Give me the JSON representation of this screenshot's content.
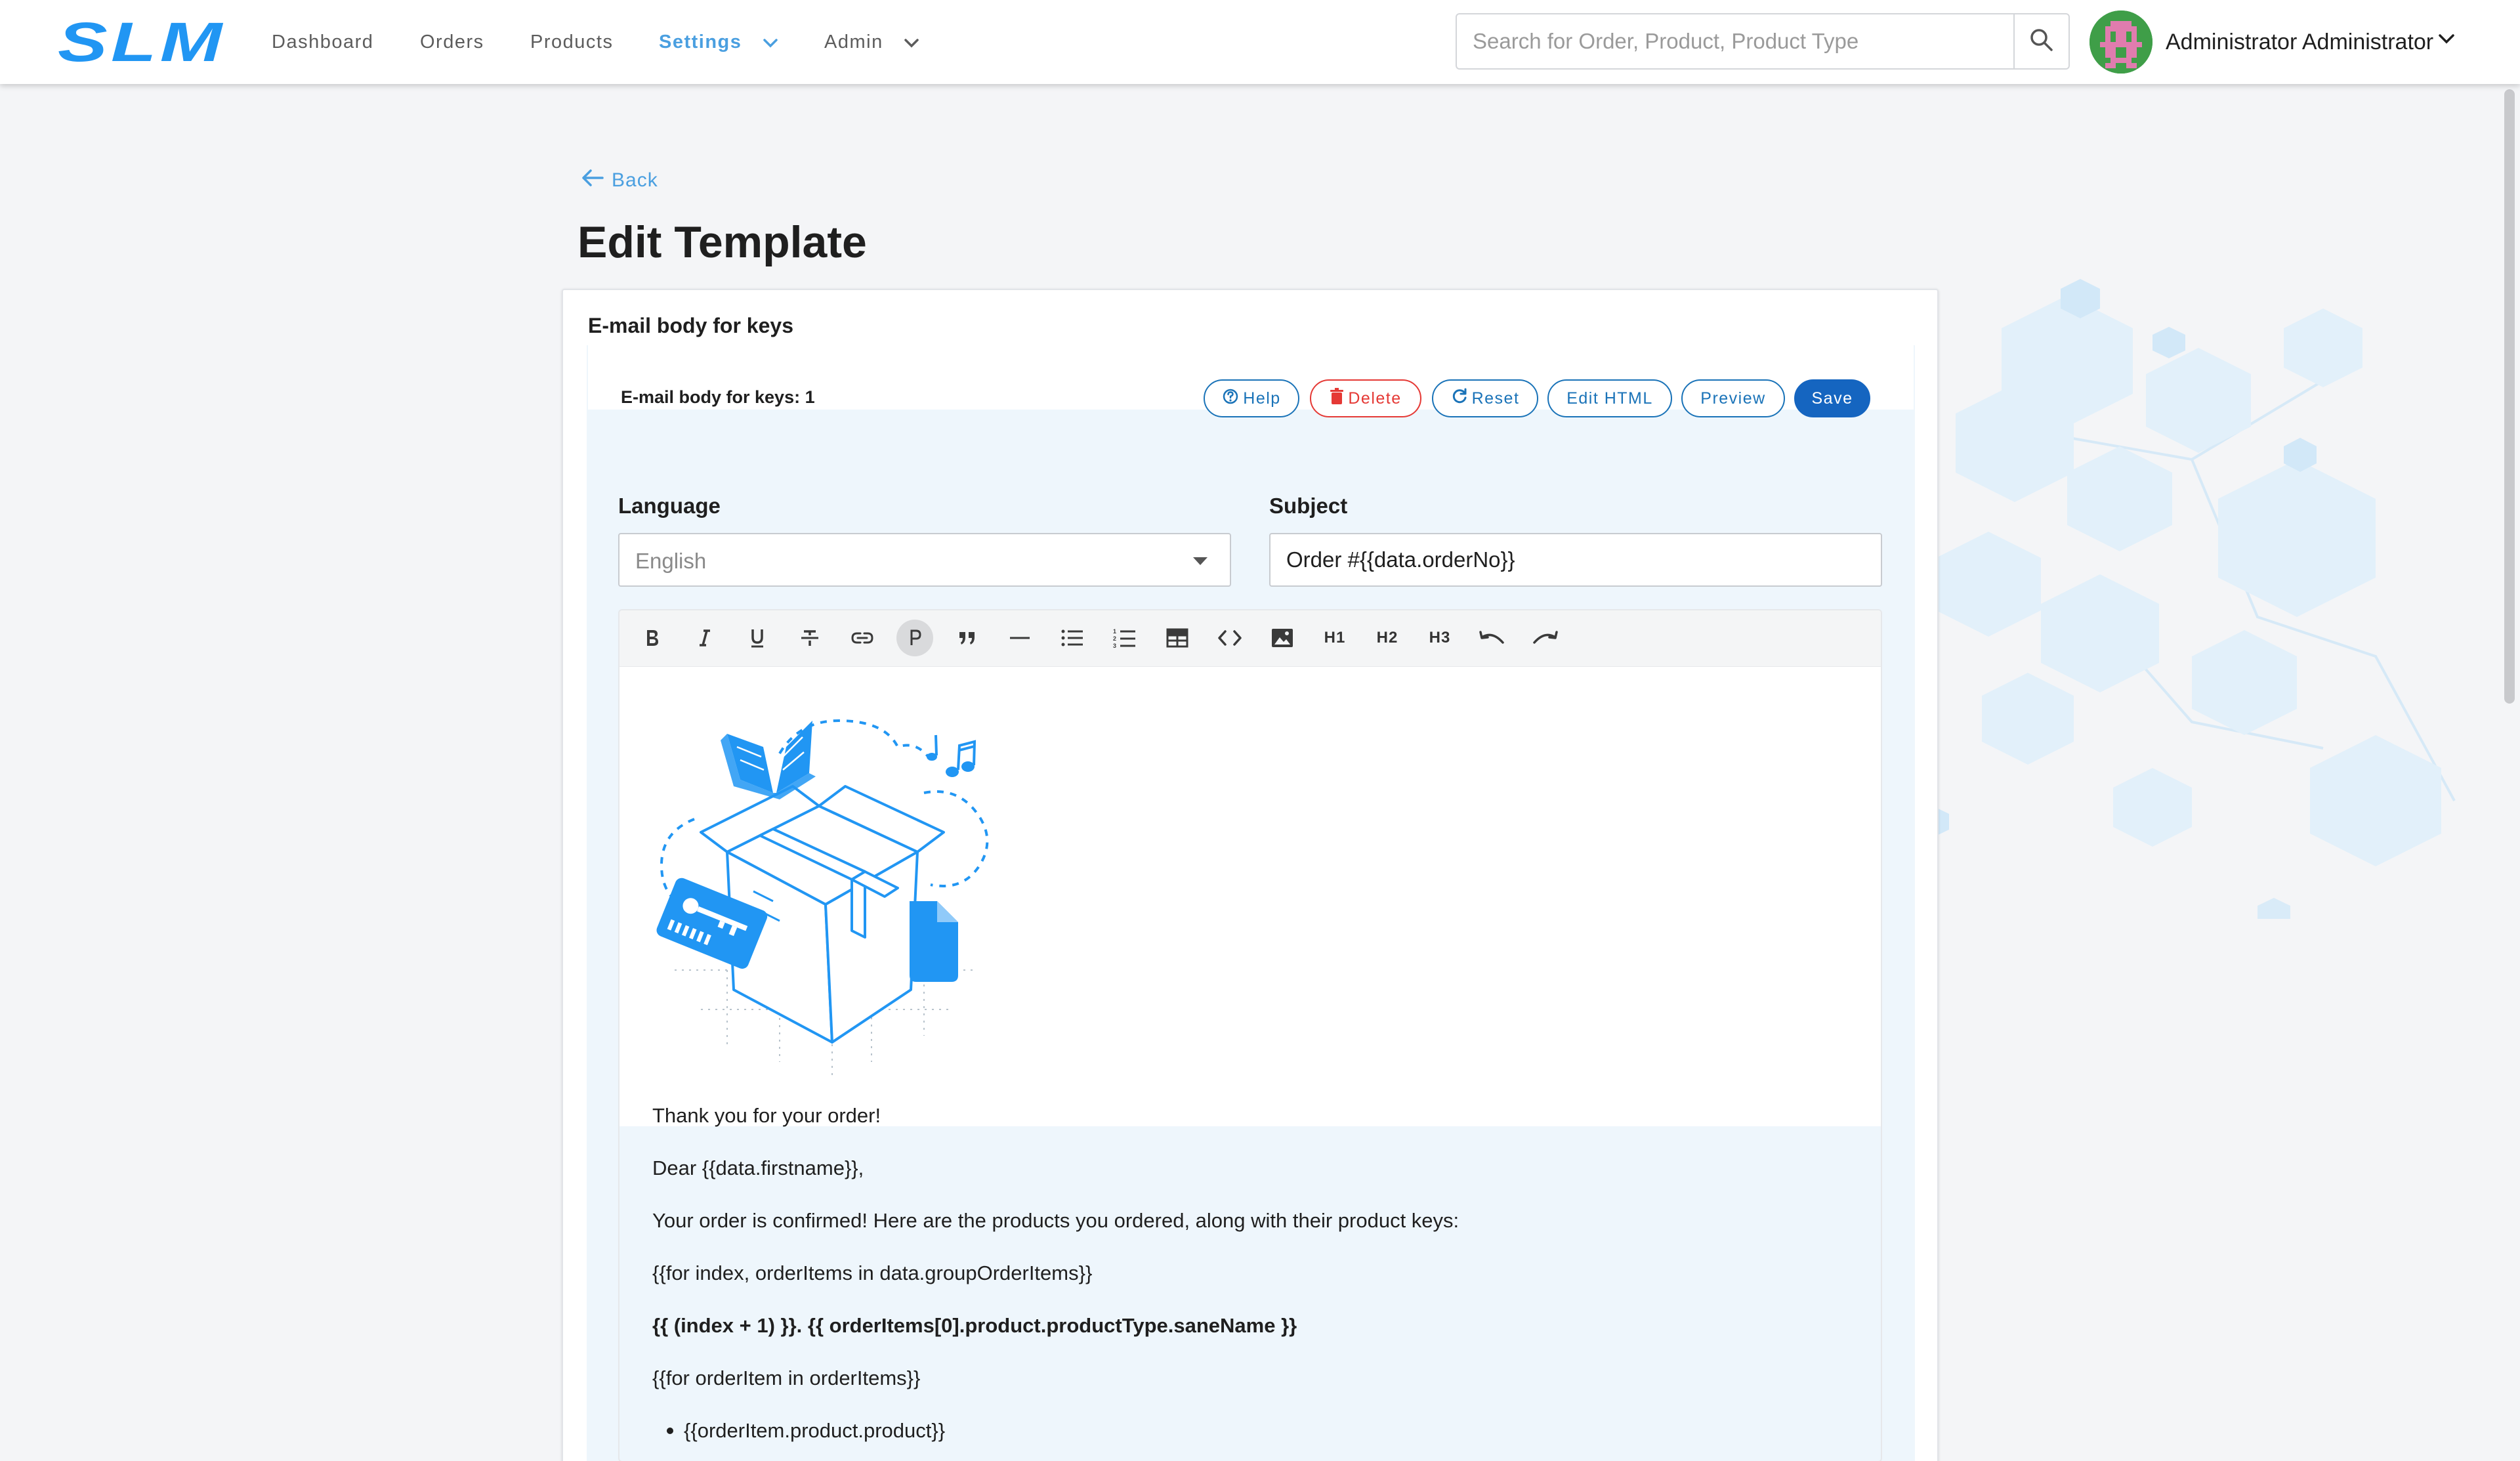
{
  "brand": {
    "logo": "SLM",
    "accent": "#2196f3"
  },
  "nav": {
    "dashboard": "Dashboard",
    "orders": "Orders",
    "products": "Products",
    "settings": "Settings",
    "admin": "Admin"
  },
  "search": {
    "placeholder": "Search for Order, Product, Product Type"
  },
  "user": {
    "name": "Administrator Administrator"
  },
  "page": {
    "back": "Back",
    "title": "Edit Template"
  },
  "template": {
    "card_title": "E-mail body for keys",
    "inner_title": "E-mail body for keys: 1",
    "buttons": {
      "help": "Help",
      "delete": "Delete",
      "reset": "Reset",
      "edit_html": "Edit HTML",
      "preview": "Preview",
      "save": "Save"
    },
    "language_label": "Language",
    "language_value": "English",
    "subject_label": "Subject",
    "subject_value": "Order #{{data.orderNo}}"
  },
  "toolbar": {
    "icons": [
      "bold-icon",
      "italic-icon",
      "underline-icon",
      "strikethrough-icon",
      "link-icon",
      "paragraph-icon",
      "blockquote-icon",
      "horizontal-rule-icon",
      "bullet-list-icon",
      "ordered-list-icon",
      "table-icon",
      "code-icon",
      "image-icon",
      "heading-1-icon",
      "heading-2-icon",
      "heading-3-icon",
      "undo-icon",
      "redo-icon"
    ],
    "h1": "H1",
    "h2": "H2",
    "h3": "H3",
    "paragraph": "P"
  },
  "editor": {
    "line1": "Thank you for your order!",
    "line2": "Dear {{data.firstname}},",
    "line3": "Your order is confirmed! Here are the products you ordered, along with their product keys:",
    "line4": "{{for index, orderItems in data.groupOrderItems}}",
    "line5": "{{ (index + 1) }}. {{ orderItems[0].product.productType.saneName }}",
    "line6": "{{for orderItem in orderItems}}",
    "line7": "{{orderItem.product.product}}"
  }
}
